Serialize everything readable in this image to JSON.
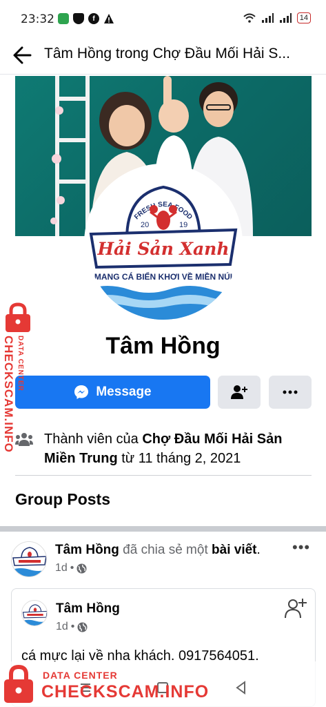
{
  "status": {
    "time": "23:32",
    "battery": "14",
    "icons": [
      "sim-icon",
      "shield-icon",
      "facebook-icon",
      "warning-icon",
      "wifi-icon",
      "signal-icon",
      "signal-icon",
      "battery-icon"
    ]
  },
  "header": {
    "title": "Tâm Hồng trong Chợ Đầu Mối Hải S..."
  },
  "profile": {
    "name": "Tâm Hồng",
    "logo": {
      "top_text": "FRESH SEA FOOD",
      "year_left": "20",
      "year_right": "19",
      "brand": "Hải Sản Xanh",
      "slogan": "MANG CÁ BIỂN KHƠI VỀ MIỀN NÚI"
    }
  },
  "actions": {
    "message_label": "Message"
  },
  "membership": {
    "prefix": "Thành viên của ",
    "group": "Chợ Đầu Mối Hải Sản Miền Trung",
    "suffix": " từ 11 tháng 2, 2021"
  },
  "section": {
    "title": "Group Posts"
  },
  "post": {
    "author": "Tâm Hồng",
    "action": " đã chia sẻ một ",
    "object": "bài viết",
    "object_suffix": ".",
    "time": "1d",
    "dot": "•",
    "more": "•••"
  },
  "shared": {
    "author": "Tâm Hồng",
    "time": "1d",
    "dot": "•",
    "text": "cá mực lại về nha khách. 0917564051."
  },
  "watermark": {
    "small": "DATA CENTER",
    "big": "CHECKSCAM.INFO"
  },
  "colors": {
    "accent": "#1877f2",
    "watermark": "#e53935",
    "secondary_text": "#65676b"
  }
}
